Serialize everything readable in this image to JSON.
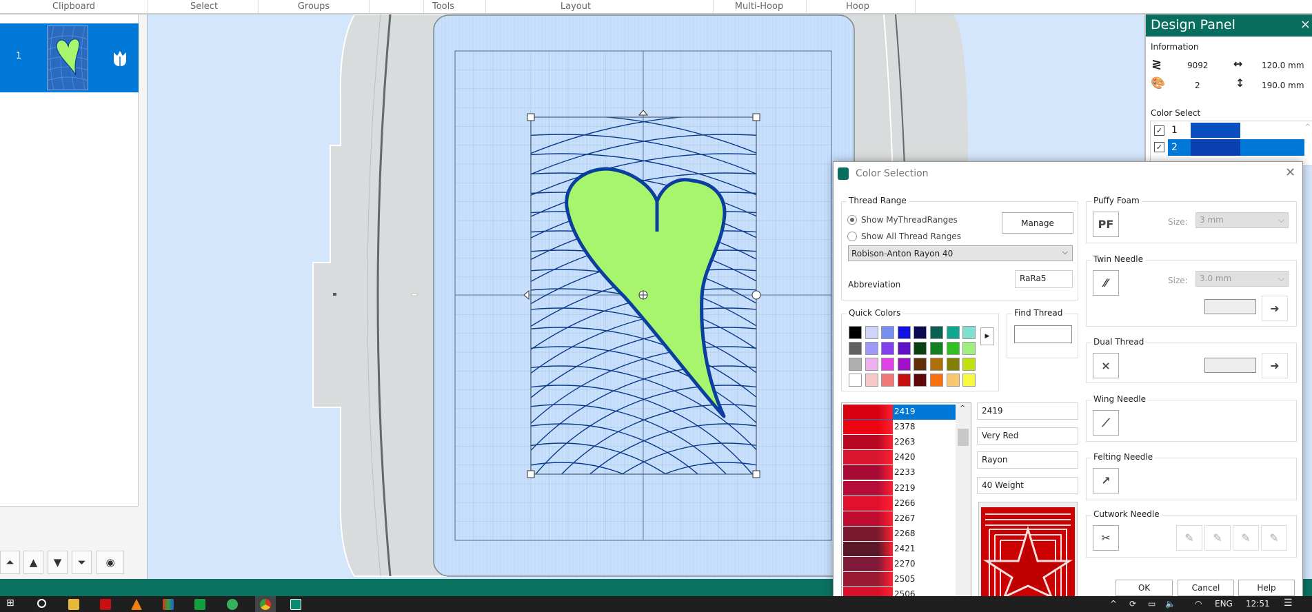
{
  "ribbon": {
    "groups": [
      "Clipboard",
      "Select",
      "Groups",
      "Tools",
      "Layout",
      "Multi-Hoop",
      "Hoop"
    ]
  },
  "left_panel": {
    "items": [
      {
        "number": "1",
        "selected": true
      }
    ],
    "buttons": [
      "move-to-top",
      "move-up",
      "move-down",
      "move-to-bottom",
      "view-options"
    ]
  },
  "design_panel": {
    "title": "Design Panel",
    "close": "×",
    "information_label": "Information",
    "stitches": "9092",
    "width": "120.0 mm",
    "colors": "2",
    "height": "190.0 mm",
    "color_select_label": "Color Select",
    "color_items": [
      {
        "number": "1",
        "checked": true,
        "color": "#0a4fc0",
        "selected": false
      },
      {
        "number": "2",
        "checked": true,
        "color": "#0a3fb0",
        "selected": true
      }
    ]
  },
  "dialog": {
    "title": "Color Selection",
    "close": "✕",
    "thread_range": {
      "label": "Thread Range",
      "option_my": "Show MyThreadRanges",
      "option_all": "Show All Thread Ranges",
      "selected_option": "Show MyThreadRanges",
      "manage": "Manage",
      "range_value": "Robison-Anton Rayon 40",
      "abbreviation_label": "Abbreviation",
      "abbreviation_value": "RaRa5"
    },
    "quick_colors": {
      "label": "Quick Colors",
      "colors": [
        "#000000",
        "#d0d4f8",
        "#7890f0",
        "#1010e0",
        "#0a0a50",
        "#0a6050",
        "#10a890",
        "#80e0d0",
        "#606060",
        "#a098f8",
        "#8040f0",
        "#6010c8",
        "#0a4010",
        "#108020",
        "#30c020",
        "#a0f080",
        "#b0b0b0",
        "#f0b0f0",
        "#e040e8",
        "#a010c8",
        "#603008",
        "#b07008",
        "#808008",
        "#c0e010",
        "#ffffff",
        "#f8c8c8",
        "#f07878",
        "#c81010",
        "#600808",
        "#f87010",
        "#f8c870",
        "#f8f840"
      ]
    },
    "find_thread": {
      "label": "Find Thread",
      "value": ""
    },
    "thread_list": [
      {
        "code": "2419",
        "color": "#d8000f",
        "selected": true
      },
      {
        "code": "2378",
        "color": "#ea0510"
      },
      {
        "code": "2263",
        "color": "#b80824"
      },
      {
        "code": "2420",
        "color": "#d81630"
      },
      {
        "code": "2233",
        "color": "#a80a36"
      },
      {
        "code": "2219",
        "color": "#b50c3a"
      },
      {
        "code": "2266",
        "color": "#e2102c"
      },
      {
        "code": "2267",
        "color": "#c00c30"
      },
      {
        "code": "2268",
        "color": "#7a1a30"
      },
      {
        "code": "2421",
        "color": "#5a1828"
      },
      {
        "code": "2270",
        "color": "#801a3a"
      },
      {
        "code": "2505",
        "color": "#9a1a32"
      },
      {
        "code": "2506",
        "color": "#d8102a"
      }
    ],
    "thread_details": {
      "code": "2419",
      "name": "Very Red",
      "type": "Rayon",
      "weight": "40 Weight"
    },
    "puffy_foam": {
      "label": "Puffy Foam",
      "size_label": "Size:",
      "size_value": "3 mm"
    },
    "twin_needle": {
      "label": "Twin Needle",
      "size_label": "Size:",
      "size_value": "3.0 mm"
    },
    "dual_thread": {
      "label": "Dual Thread"
    },
    "wing_needle": {
      "label": "Wing Needle"
    },
    "felting_needle": {
      "label": "Felting Needle"
    },
    "cutwork_needle": {
      "label": "Cutwork Needle"
    },
    "footer_buttons": [
      "OK",
      "Cancel",
      "Help"
    ]
  },
  "taskbar": {
    "language": "ENG",
    "time": "12:51"
  },
  "colors": {
    "accent": "#0078d7",
    "brand_green": "#0a6e5e",
    "canvas": "#d4e6fb",
    "heart_fill": "#a6f56c",
    "outline": "#0a3f9e"
  }
}
